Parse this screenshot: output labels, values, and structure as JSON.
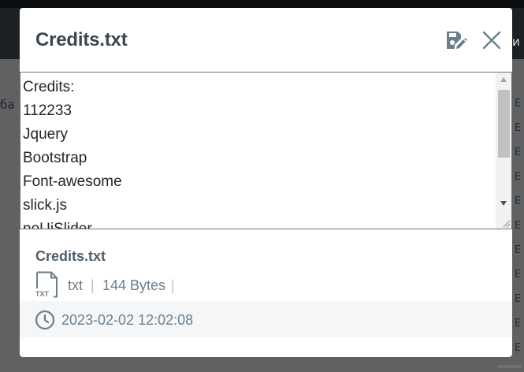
{
  "background": {
    "left_fragment": "ба",
    "nav_fragment": "и",
    "right_markers": [
      "E",
      "E",
      "E",
      "E",
      "E",
      "E",
      "E",
      "E",
      "E",
      "E",
      "E"
    ]
  },
  "modal": {
    "title": "Credits.txt",
    "save_icon": "save-edit-icon",
    "close_icon": "close-icon",
    "editor_content": "Credits:\n112233\nJquery\nBootstrap\nFont-awesome\nslick.js\nnoUiSlider",
    "file": {
      "name": "Credits.txt",
      "icon": "txt-file-icon",
      "icon_label": "TXT",
      "extension": "txt",
      "separator": "|",
      "size": "144 Bytes",
      "date_icon": "clock-icon",
      "modified": "2023-02-02 12:02:08"
    }
  },
  "colors": {
    "title": "#3b4650",
    "meta": "#6a7f8e",
    "icon": "#6a7f8e",
    "date_row_bg": "#f5f6f8"
  }
}
